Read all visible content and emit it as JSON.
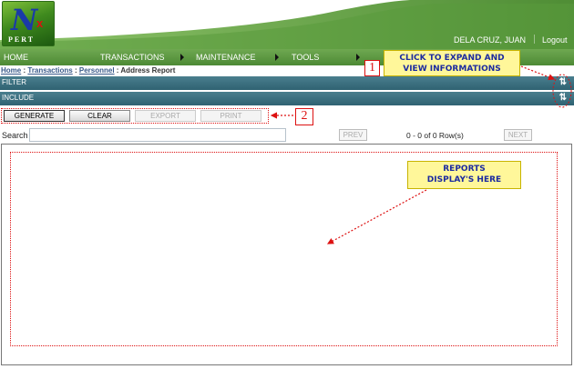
{
  "logo": {
    "letter": "N",
    "superscript": "x",
    "text": "PERT"
  },
  "user": {
    "name": "DELA CRUZ, JUAN",
    "logout": "Logout"
  },
  "nav": {
    "home": "HOME",
    "transactions": "TRANSACTIONS",
    "maintenance": "MAINTENANCE",
    "tools": "TOOLS"
  },
  "breadcrumb": {
    "home": "Home",
    "sep": ":",
    "transactions": "Transactions",
    "personnel": "Personnel",
    "current": "Address Report"
  },
  "sections": {
    "filter": "FILTER",
    "include": "INCLUDE",
    "toggle_icon": "sort-toggle-icon"
  },
  "toolbar": {
    "generate": "GENERATE",
    "clear": "CLEAR",
    "export": "EXPORT",
    "print": "PRINT"
  },
  "search": {
    "label": "Search",
    "value": ""
  },
  "pager": {
    "prev": "PREV",
    "info": "0 - 0 of 0 Row(s)",
    "next": "NEXT"
  },
  "callouts": {
    "one_number": "1",
    "one_text_line1": "CLICK TO EXPAND AND",
    "one_text_line2": "VIEW INFORMATIONS",
    "two_number": "2",
    "reports_line1": "REPORTS",
    "reports_line2": "DISPLAY'S HERE"
  },
  "colors": {
    "nav_green": "#4d8a35",
    "section_teal": "#2f6272",
    "callout_yellow": "#fff79a",
    "annotation_red": "#dd1111",
    "callout_text_blue": "#1b2aa0"
  }
}
